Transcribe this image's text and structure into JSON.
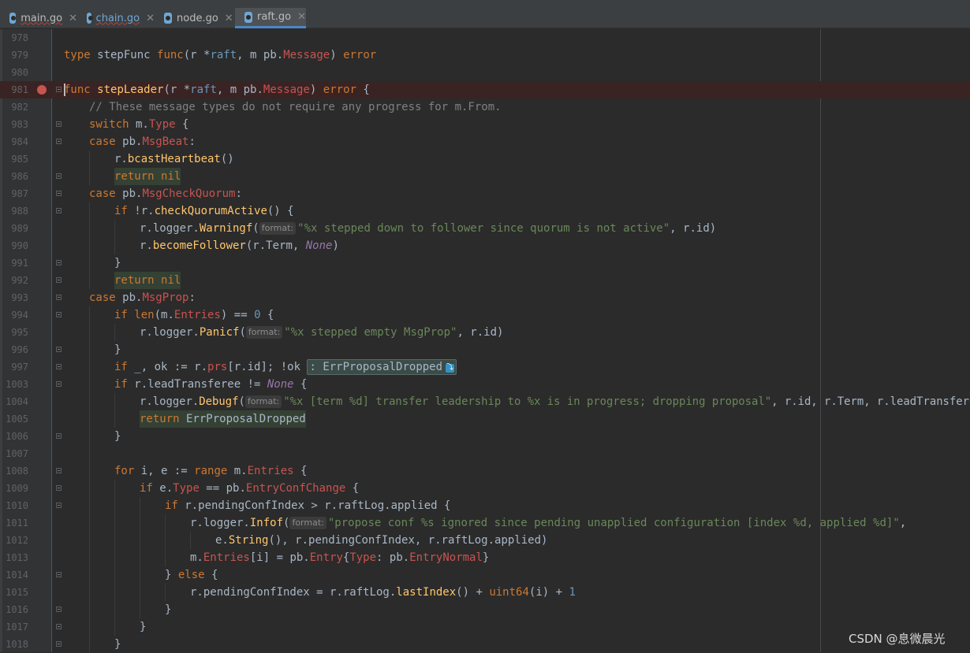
{
  "tabs": [
    {
      "label": "main.go",
      "active": false,
      "underline": true
    },
    {
      "label": "chain.go",
      "active": false,
      "underline": true
    },
    {
      "label": "node.go",
      "active": false,
      "underline": false
    },
    {
      "label": "raft.go",
      "active": true,
      "underline": false
    }
  ],
  "line_numbers": [
    "978",
    "979",
    "980",
    "981",
    "982",
    "983",
    "984",
    "985",
    "986",
    "987",
    "988",
    "989",
    "990",
    "991",
    "992",
    "993",
    "994",
    "995",
    "996",
    "997",
    "1003",
    "1004",
    "1005",
    "1006",
    "1007",
    "1008",
    "1009",
    "1010",
    "1011",
    "1012",
    "1013",
    "1014",
    "1015",
    "1016",
    "1017",
    "1018"
  ],
  "param_hint": "format:",
  "inline_fold_text": ": ErrProposalDropped",
  "watermark": "CSDN @息微晨光",
  "colors": {
    "background": "#2b2b2b",
    "keyword": "#cc7832",
    "function": "#ffc66d",
    "string": "#6a8759",
    "comment": "#808080",
    "number": "#6897bb",
    "member": "#c75450",
    "breakpoint": "#c75450"
  },
  "code": {
    "l979": {
      "t1": "type",
      "t2": " stepFunc ",
      "t3": "func",
      "t4": "(r *",
      "t5": "raft",
      "t6": ", m pb.",
      "t7": "Message",
      "t8": ") ",
      "t9": "error"
    },
    "l981": {
      "t1": "func",
      "t2": "stepLeader",
      "t3": "(r *",
      "t4": "raft",
      "t5": ", m pb.",
      "t6": "Message",
      "t7": ") ",
      "t8": "error",
      "t9": " {"
    },
    "l982": {
      "t1": "// These message types do not require any progress for m.From."
    },
    "l983": {
      "t1": "switch",
      "t2": " m.",
      "t3": "Type",
      "t4": " {"
    },
    "l984": {
      "t1": "case",
      "t2": " pb.",
      "t3": "MsgBeat",
      "t4": ":"
    },
    "l985": {
      "t1": "r.",
      "t2": "bcastHeartbeat",
      "t3": "()"
    },
    "l986": {
      "t1": "return",
      "t2": " ",
      "t3": "nil"
    },
    "l987": {
      "t1": "case",
      "t2": " pb.",
      "t3": "MsgCheckQuorum",
      "t4": ":"
    },
    "l988": {
      "t1": "if",
      "t2": " !r.",
      "t3": "checkQuorumActive",
      "t4": "() {"
    },
    "l989": {
      "t1": "r.logger.",
      "t2": "Warningf",
      "t3": "(",
      "t4": "\"%x stepped down to follower since quorum is not active\"",
      "t5": ", r.id)"
    },
    "l990": {
      "t1": "r.",
      "t2": "becomeFollower",
      "t3": "(r.Term, ",
      "t4": "None",
      "t5": ")"
    },
    "l991": {
      "t1": "}"
    },
    "l992": {
      "t1": "return",
      "t2": " ",
      "t3": "nil"
    },
    "l993": {
      "t1": "case",
      "t2": " pb.",
      "t3": "MsgProp",
      "t4": ":"
    },
    "l994": {
      "t1": "if",
      "t2": " ",
      "t3": "len",
      "t4": "(m.",
      "t5": "Entries",
      "t6": ") == ",
      "t7": "0",
      "t8": " {"
    },
    "l995": {
      "t1": "r.logger.",
      "t2": "Panicf",
      "t3": "(",
      "t4": "\"%x stepped empty MsgProp\"",
      "t5": ", r.id)"
    },
    "l996": {
      "t1": "}"
    },
    "l997": {
      "t1": "if",
      "t2": " _, ok := r.",
      "t3": "prs",
      "t4": "[r.id]; !ok "
    },
    "l1003": {
      "t1": "if",
      "t2": " r.leadTransferee != ",
      "t3": "None",
      "t4": " {"
    },
    "l1004": {
      "t1": "r.logger.",
      "t2": "Debugf",
      "t3": "(",
      "t4": "\"%x [term %d] transfer leadership to %x is in progress; dropping proposal\"",
      "t5": ", r.id, r.Term, r.leadTransferee)"
    },
    "l1005": {
      "t1": "return",
      "t2": " ErrProposalDropped"
    },
    "l1006": {
      "t1": "}"
    },
    "l1008": {
      "t1": "for",
      "t2": " i, e := ",
      "t3": "range",
      "t4": " m.",
      "t5": "Entries",
      "t6": " {"
    },
    "l1009": {
      "t1": "if",
      "t2": " e.",
      "t3": "Type",
      "t4": " == pb.",
      "t5": "EntryConfChange",
      "t6": " {"
    },
    "l1010": {
      "t1": "if",
      "t2": " r.pendingConfIndex > r.raftLog.applied {"
    },
    "l1011": {
      "t1": "r.logger.",
      "t2": "Infof",
      "t3": "(",
      "t4": "\"propose conf %s ignored since pending unapplied configuration [index %d, applied %d]\"",
      "t5": ","
    },
    "l1012": {
      "t1": "e.",
      "t2": "String",
      "t3": "(), r.pendingConfIndex, r.raftLog.applied)"
    },
    "l1013": {
      "t1": "m.",
      "t2": "Entries",
      "t3": "[i] = pb.",
      "t4": "Entry",
      "t5": "{",
      "t6": "Type",
      "t7": ": pb.",
      "t8": "EntryNormal",
      "t9": "}"
    },
    "l1014": {
      "t1": "} ",
      "t2": "else",
      "t3": " {"
    },
    "l1015": {
      "t1": "r.pendingConfIndex = r.raftLog.",
      "t2": "lastIndex",
      "t3": "() + ",
      "t4": "uint64",
      "t5": "(i) + ",
      "t6": "1"
    },
    "l1016": {
      "t1": "}"
    },
    "l1017": {
      "t1": "}"
    },
    "l1018": {
      "t1": "}"
    }
  }
}
